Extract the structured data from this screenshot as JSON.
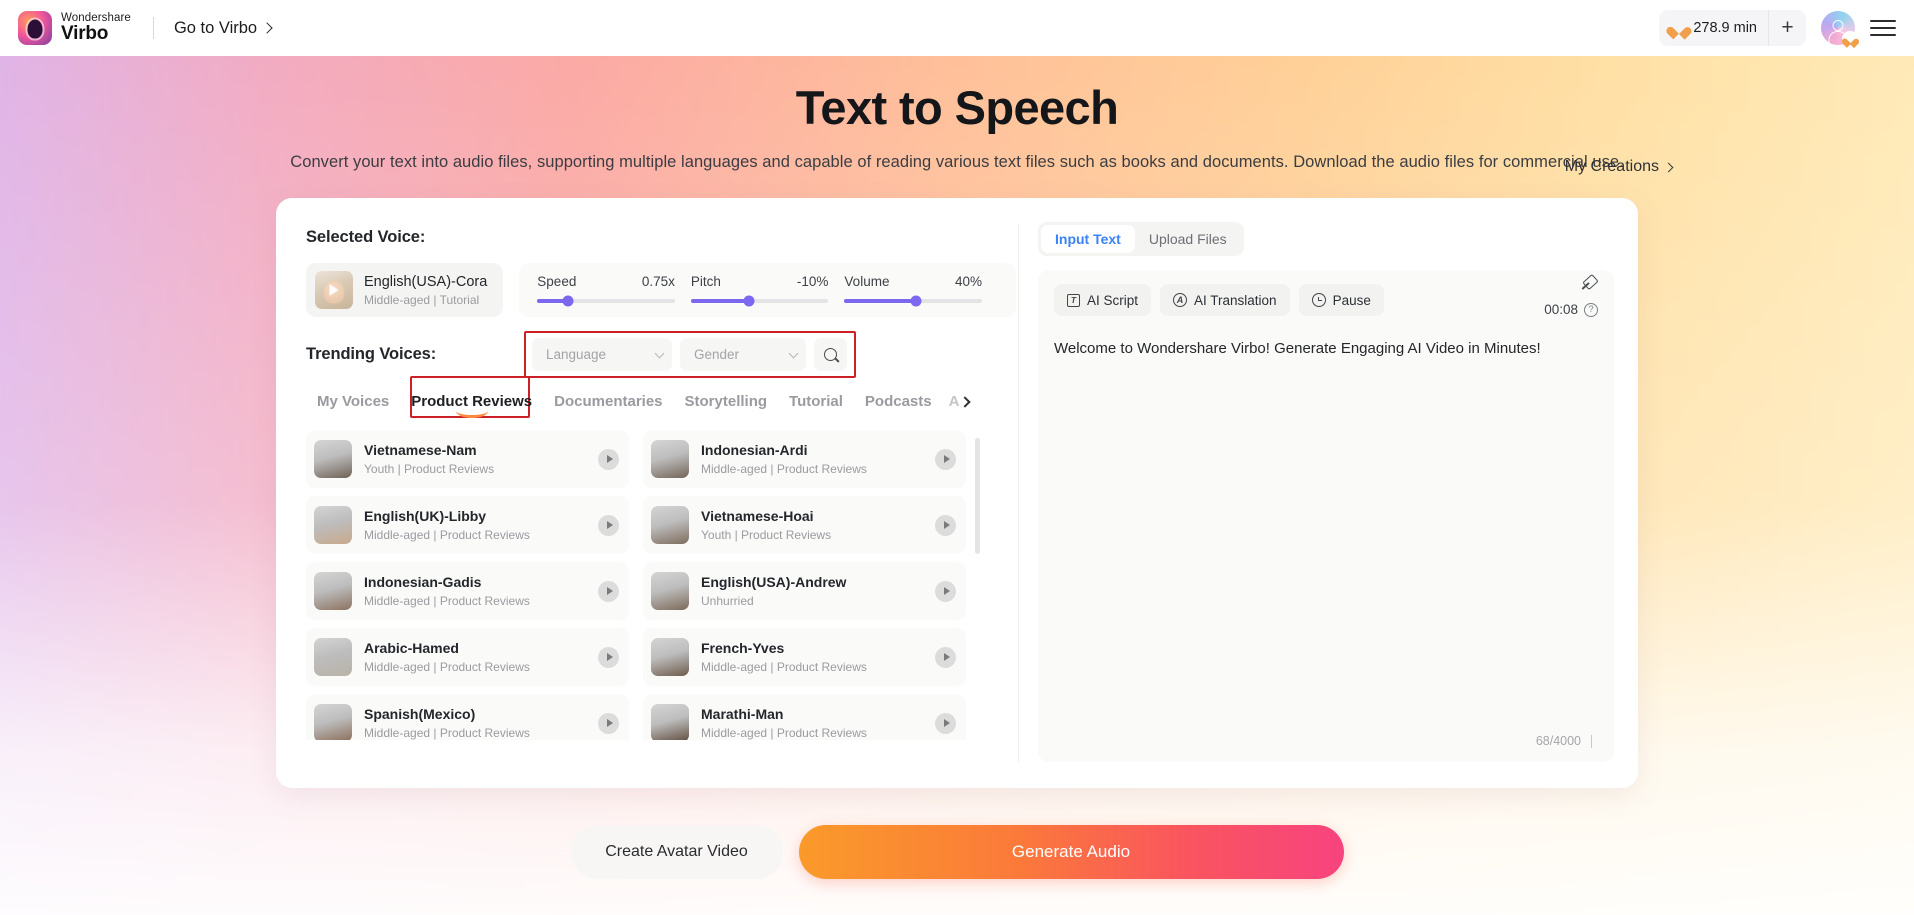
{
  "topbar": {
    "brand_top": "Wondershare",
    "brand_bottom": "Virbo",
    "goto_label": "Go to Virbo",
    "credits": "278.9 min",
    "plus_label": "+"
  },
  "hero": {
    "title": "Text to Speech",
    "subtitle": "Convert your text into audio files, supporting multiple languages and capable of reading various text files such as books and documents. Download the audio files for commercial use.",
    "my_creations": "My Creations"
  },
  "voice_panel": {
    "selected_voice_label": "Selected Voice:",
    "selected": {
      "name": "English(USA)-Cora",
      "meta": "Middle-aged | Tutorial"
    },
    "sliders": [
      {
        "label": "Speed",
        "value": "0.75x",
        "fill_pct": 22
      },
      {
        "label": "Pitch",
        "value": "-10%",
        "fill_pct": 42
      },
      {
        "label": "Volume",
        "value": "40%",
        "fill_pct": 52
      }
    ],
    "trending_label": "Trending Voices:",
    "filters": {
      "language_placeholder": "Language",
      "gender_placeholder": "Gender"
    },
    "tabs": [
      {
        "label": "My Voices",
        "active": false
      },
      {
        "label": "Product Reviews",
        "active": true
      },
      {
        "label": "Documentaries",
        "active": false
      },
      {
        "label": "Storytelling",
        "active": false
      },
      {
        "label": "Tutorial",
        "active": false
      },
      {
        "label": "Podcasts",
        "active": false
      }
    ],
    "tab_more_label": "A",
    "voices": [
      {
        "name": "Vietnamese-Nam",
        "meta": "Youth | Product Reviews",
        "tone": "#6f6256"
      },
      {
        "name": "Indonesian-Ardi",
        "meta": "Middle-aged | Product Reviews",
        "tone": "#746558"
      },
      {
        "name": "English(UK)-Libby",
        "meta": "Middle-aged | Product Reviews",
        "tone": "#c9a98c"
      },
      {
        "name": "Vietnamese-Hoai",
        "meta": "Youth | Product Reviews",
        "tone": "#7e6c5d"
      },
      {
        "name": "Indonesian-Gadis",
        "meta": "Middle-aged | Product Reviews",
        "tone": "#8c7360"
      },
      {
        "name": "English(USA)-Andrew",
        "meta": "Unhurried",
        "tone": "#7d6a58"
      },
      {
        "name": "Arabic-Hamed",
        "meta": "Middle-aged | Product Reviews",
        "tone": "#b9b3a8"
      },
      {
        "name": "French-Yves",
        "meta": "Middle-aged | Product Reviews",
        "tone": "#6e5c4c"
      },
      {
        "name": "Spanish(Mexico)",
        "meta": "Middle-aged | Product Reviews",
        "tone": "#8a6d59"
      },
      {
        "name": "Marathi-Man",
        "meta": "Middle-aged | Product Reviews",
        "tone": "#5f4c3c"
      },
      {
        "name": "",
        "meta": "",
        "tone": "#4a3b30"
      },
      {
        "name": "",
        "meta": "",
        "tone": "#5a4a3c"
      }
    ]
  },
  "editor": {
    "tabs": [
      {
        "label": "Input Text",
        "active": true
      },
      {
        "label": "Upload Files",
        "active": false
      }
    ],
    "tools": [
      {
        "label": "AI Script",
        "icon": "text-box-icon"
      },
      {
        "label": "AI Translation",
        "icon": "translate-icon"
      },
      {
        "label": "Pause",
        "icon": "clock-icon"
      }
    ],
    "duration": "00:08",
    "help_label": "?",
    "text": "Welcome to Wondershare Virbo! Generate Engaging AI Video in Minutes!",
    "counter": "68/4000"
  },
  "actions": {
    "secondary": "Create Avatar Video",
    "primary": "Generate Audio"
  }
}
